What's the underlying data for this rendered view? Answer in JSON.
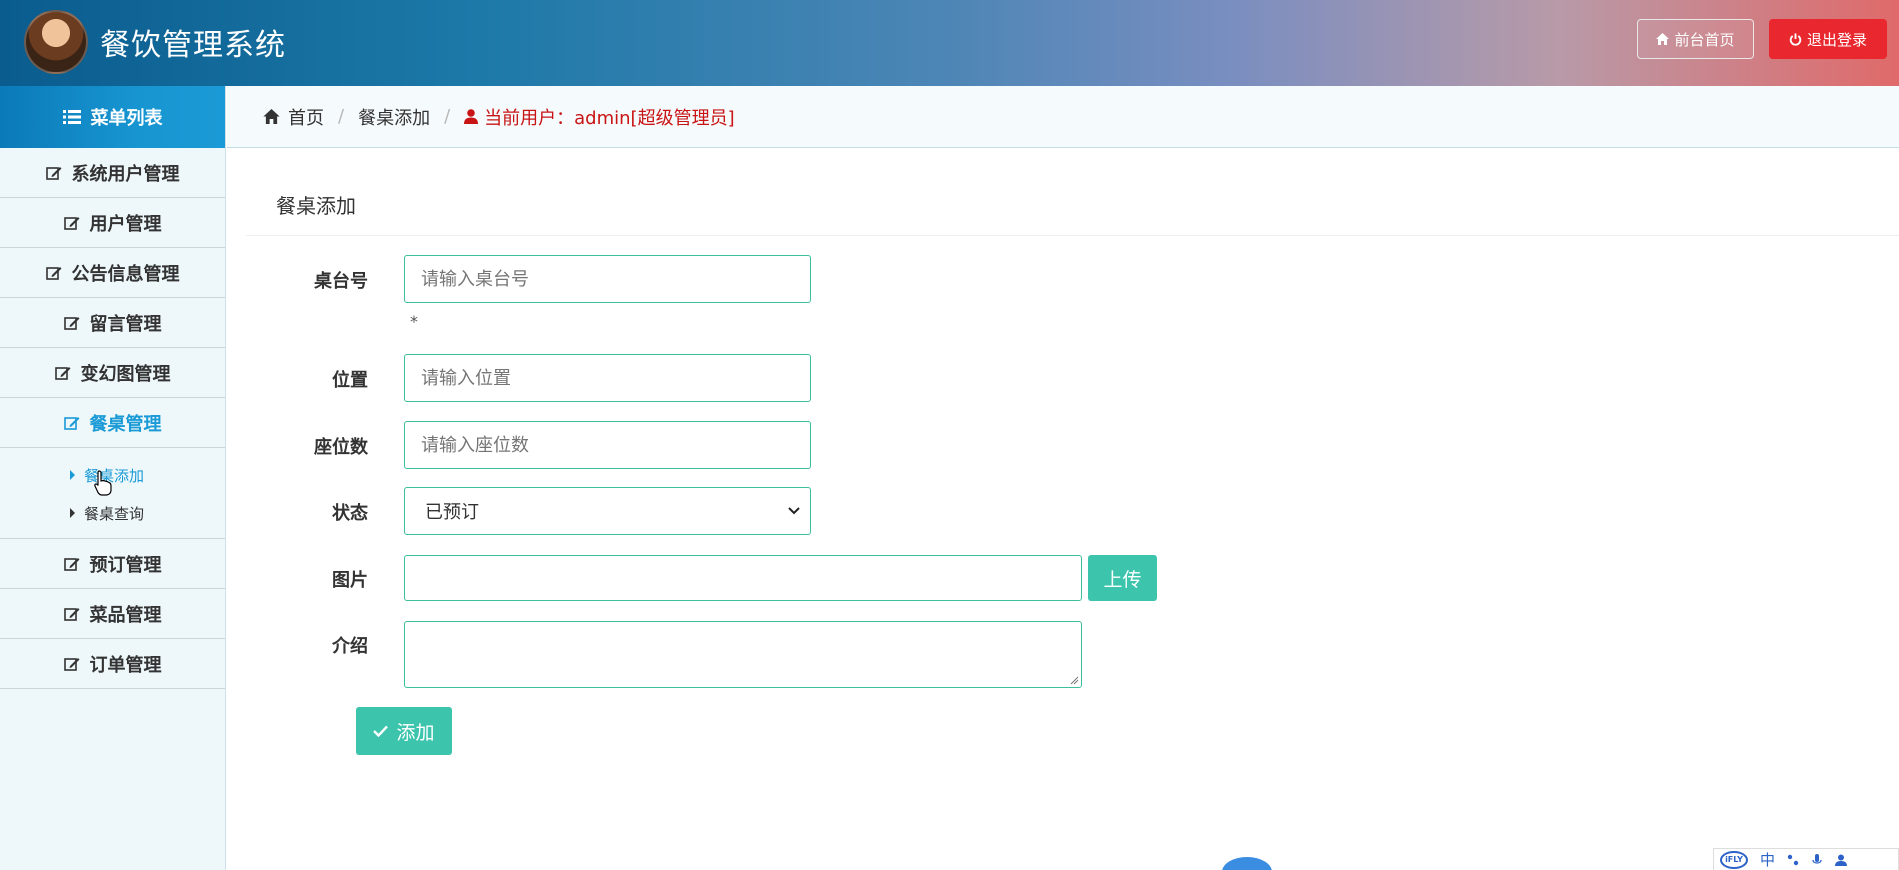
{
  "header": {
    "app_title": "餐饮管理系统",
    "home_button": "前台首页",
    "logout_button": "退出登录"
  },
  "sidebar": {
    "title": "菜单列表",
    "items": [
      {
        "label": "系统用户管理",
        "icon": "edit-icon"
      },
      {
        "label": "用户管理",
        "icon": "edit-icon"
      },
      {
        "label": "公告信息管理",
        "icon": "edit-icon"
      },
      {
        "label": "留言管理",
        "icon": "edit-icon"
      },
      {
        "label": "变幻图管理",
        "icon": "edit-icon"
      },
      {
        "label": "餐桌管理",
        "icon": "edit-icon",
        "active": true
      },
      {
        "label": "预订管理",
        "icon": "edit-icon"
      },
      {
        "label": "菜品管理",
        "icon": "edit-icon"
      },
      {
        "label": "订单管理",
        "icon": "edit-icon"
      }
    ],
    "submenu": [
      {
        "label": "餐桌添加",
        "active": true
      },
      {
        "label": "餐桌查询"
      }
    ]
  },
  "breadcrumb": {
    "home": "首页",
    "current": "餐桌添加",
    "user": "当前用户：admin[超级管理员]"
  },
  "form": {
    "title": "餐桌添加",
    "table_no": {
      "label": "桌台号",
      "placeholder": "请输入桌台号",
      "value": ""
    },
    "required_mark": "*",
    "location": {
      "label": "位置",
      "placeholder": "请输入位置",
      "value": ""
    },
    "seats": {
      "label": "座位数",
      "placeholder": "请输入座位数",
      "value": ""
    },
    "status": {
      "label": "状态",
      "value": "已预订"
    },
    "image": {
      "label": "图片",
      "value": "",
      "upload_button": "上传"
    },
    "intro": {
      "label": "介绍",
      "value": ""
    },
    "submit_button": "添加"
  },
  "ime_toolbar": {
    "logo": "iFLY",
    "mode": "中"
  },
  "colors": {
    "accent_green": "#3cc4ad",
    "accent_blue": "#1a9ad6",
    "danger": "#e8282e",
    "user_red": "#c81414"
  }
}
